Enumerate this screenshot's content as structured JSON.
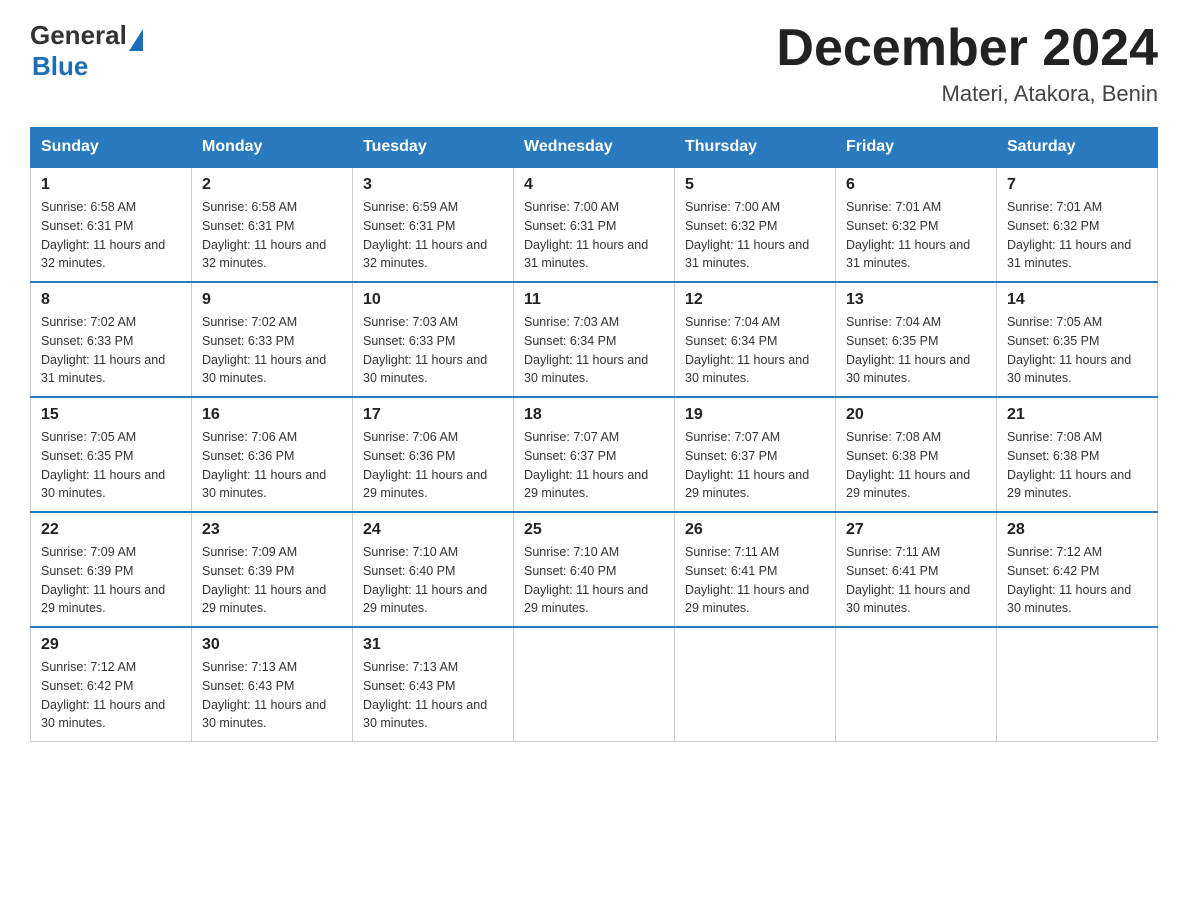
{
  "logo": {
    "general": "General",
    "blue": "Blue"
  },
  "title": "December 2024",
  "subtitle": "Materi, Atakora, Benin",
  "days_of_week": [
    "Sunday",
    "Monday",
    "Tuesday",
    "Wednesday",
    "Thursday",
    "Friday",
    "Saturday"
  ],
  "weeks": [
    [
      {
        "day": "1",
        "sunrise": "6:58 AM",
        "sunset": "6:31 PM",
        "daylight": "11 hours and 32 minutes."
      },
      {
        "day": "2",
        "sunrise": "6:58 AM",
        "sunset": "6:31 PM",
        "daylight": "11 hours and 32 minutes."
      },
      {
        "day": "3",
        "sunrise": "6:59 AM",
        "sunset": "6:31 PM",
        "daylight": "11 hours and 32 minutes."
      },
      {
        "day": "4",
        "sunrise": "7:00 AM",
        "sunset": "6:31 PM",
        "daylight": "11 hours and 31 minutes."
      },
      {
        "day": "5",
        "sunrise": "7:00 AM",
        "sunset": "6:32 PM",
        "daylight": "11 hours and 31 minutes."
      },
      {
        "day": "6",
        "sunrise": "7:01 AM",
        "sunset": "6:32 PM",
        "daylight": "11 hours and 31 minutes."
      },
      {
        "day": "7",
        "sunrise": "7:01 AM",
        "sunset": "6:32 PM",
        "daylight": "11 hours and 31 minutes."
      }
    ],
    [
      {
        "day": "8",
        "sunrise": "7:02 AM",
        "sunset": "6:33 PM",
        "daylight": "11 hours and 31 minutes."
      },
      {
        "day": "9",
        "sunrise": "7:02 AM",
        "sunset": "6:33 PM",
        "daylight": "11 hours and 30 minutes."
      },
      {
        "day": "10",
        "sunrise": "7:03 AM",
        "sunset": "6:33 PM",
        "daylight": "11 hours and 30 minutes."
      },
      {
        "day": "11",
        "sunrise": "7:03 AM",
        "sunset": "6:34 PM",
        "daylight": "11 hours and 30 minutes."
      },
      {
        "day": "12",
        "sunrise": "7:04 AM",
        "sunset": "6:34 PM",
        "daylight": "11 hours and 30 minutes."
      },
      {
        "day": "13",
        "sunrise": "7:04 AM",
        "sunset": "6:35 PM",
        "daylight": "11 hours and 30 minutes."
      },
      {
        "day": "14",
        "sunrise": "7:05 AM",
        "sunset": "6:35 PM",
        "daylight": "11 hours and 30 minutes."
      }
    ],
    [
      {
        "day": "15",
        "sunrise": "7:05 AM",
        "sunset": "6:35 PM",
        "daylight": "11 hours and 30 minutes."
      },
      {
        "day": "16",
        "sunrise": "7:06 AM",
        "sunset": "6:36 PM",
        "daylight": "11 hours and 30 minutes."
      },
      {
        "day": "17",
        "sunrise": "7:06 AM",
        "sunset": "6:36 PM",
        "daylight": "11 hours and 29 minutes."
      },
      {
        "day": "18",
        "sunrise": "7:07 AM",
        "sunset": "6:37 PM",
        "daylight": "11 hours and 29 minutes."
      },
      {
        "day": "19",
        "sunrise": "7:07 AM",
        "sunset": "6:37 PM",
        "daylight": "11 hours and 29 minutes."
      },
      {
        "day": "20",
        "sunrise": "7:08 AM",
        "sunset": "6:38 PM",
        "daylight": "11 hours and 29 minutes."
      },
      {
        "day": "21",
        "sunrise": "7:08 AM",
        "sunset": "6:38 PM",
        "daylight": "11 hours and 29 minutes."
      }
    ],
    [
      {
        "day": "22",
        "sunrise": "7:09 AM",
        "sunset": "6:39 PM",
        "daylight": "11 hours and 29 minutes."
      },
      {
        "day": "23",
        "sunrise": "7:09 AM",
        "sunset": "6:39 PM",
        "daylight": "11 hours and 29 minutes."
      },
      {
        "day": "24",
        "sunrise": "7:10 AM",
        "sunset": "6:40 PM",
        "daylight": "11 hours and 29 minutes."
      },
      {
        "day": "25",
        "sunrise": "7:10 AM",
        "sunset": "6:40 PM",
        "daylight": "11 hours and 29 minutes."
      },
      {
        "day": "26",
        "sunrise": "7:11 AM",
        "sunset": "6:41 PM",
        "daylight": "11 hours and 29 minutes."
      },
      {
        "day": "27",
        "sunrise": "7:11 AM",
        "sunset": "6:41 PM",
        "daylight": "11 hours and 30 minutes."
      },
      {
        "day": "28",
        "sunrise": "7:12 AM",
        "sunset": "6:42 PM",
        "daylight": "11 hours and 30 minutes."
      }
    ],
    [
      {
        "day": "29",
        "sunrise": "7:12 AM",
        "sunset": "6:42 PM",
        "daylight": "11 hours and 30 minutes."
      },
      {
        "day": "30",
        "sunrise": "7:13 AM",
        "sunset": "6:43 PM",
        "daylight": "11 hours and 30 minutes."
      },
      {
        "day": "31",
        "sunrise": "7:13 AM",
        "sunset": "6:43 PM",
        "daylight": "11 hours and 30 minutes."
      },
      null,
      null,
      null,
      null
    ]
  ]
}
